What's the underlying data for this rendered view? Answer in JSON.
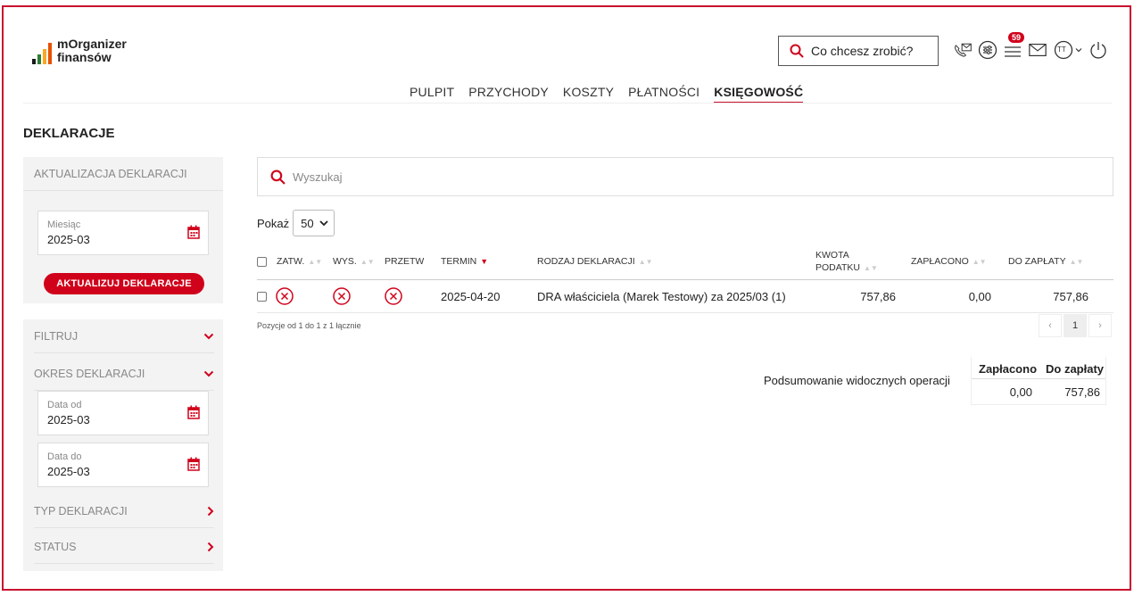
{
  "header": {
    "logo_line1": "mOrganizer",
    "logo_line2": "finansów",
    "search_placeholder": "Co chcesz zrobić?",
    "notifications_count": "59",
    "avatar_initials": "TT"
  },
  "nav": {
    "items": [
      "PULPIT",
      "PRZYCHODY",
      "KOSZTY",
      "PŁATNOŚCI",
      "KSIĘGOWOŚĆ"
    ],
    "active": "KSIĘGOWOŚĆ"
  },
  "page": {
    "title": "DEKLARACJE"
  },
  "sidebar": {
    "update_header": "AKTUALIZACJA DEKLARACJI",
    "month_label": "Miesiąc",
    "month_value": "2025-03",
    "update_button": "AKTUALIZUJ DEKLARACJE",
    "filter_label": "FILTRUJ",
    "period_label": "OKRES DEKLARACJI",
    "date_from_label": "Data od",
    "date_from_value": "2025-03",
    "date_to_label": "Data do",
    "date_to_value": "2025-03",
    "type_label": "TYP DEKLARACJI",
    "status_label": "STATUS"
  },
  "main": {
    "search_placeholder": "Wyszukaj",
    "show_label": "Pokaż",
    "show_value": "50",
    "columns": {
      "approved": "ZATW.",
      "sent": "WYS.",
      "processed": "PRZETW",
      "deadline": "TERMIN",
      "type": "RODZAJ DEKLARACJI",
      "tax_amount_1": "KWOTA",
      "tax_amount_2": "PODATKU",
      "paid": "ZAPŁACONO",
      "due": "DO ZAPŁATY"
    },
    "rows": [
      {
        "deadline": "2025-04-20",
        "type": "DRA właściciela (Marek Testowy) za 2025/03 (1)",
        "tax_amount": "757,86",
        "paid": "0,00",
        "due": "757,86"
      }
    ],
    "positions_text": "Pozycje od 1 do 1 z 1 łącznie",
    "pager": {
      "prev": "‹",
      "current": "1",
      "next": "›"
    },
    "summary": {
      "label": "Podsumowanie widocznych operacji",
      "paid_header": "Zapłacono",
      "due_header": "Do zapłaty",
      "paid_value": "0,00",
      "due_value": "757,86"
    }
  },
  "colors": {
    "accent": "#d0021b",
    "border": "#c8102e"
  }
}
